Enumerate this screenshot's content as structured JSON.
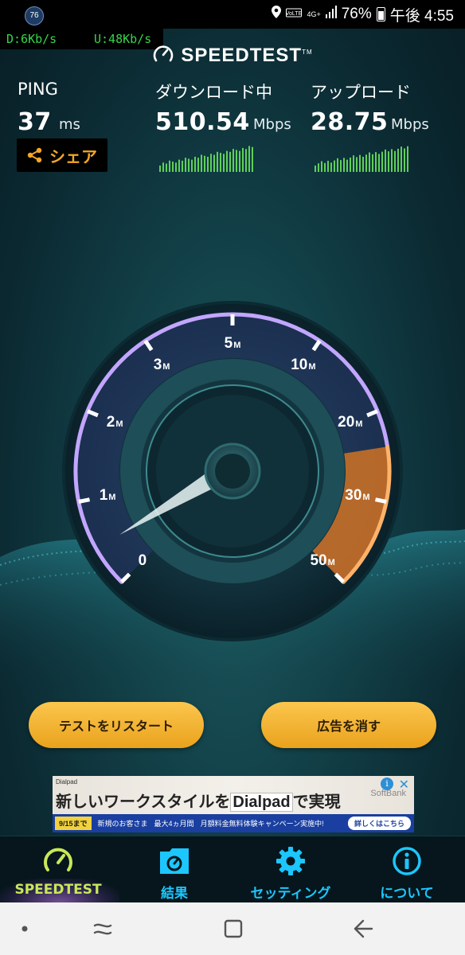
{
  "status_bar": {
    "badge": "76",
    "network_type": "4G+",
    "battery": "76%",
    "time": "午後 4:55",
    "icons": [
      "location-icon",
      "volte-icon",
      "network-4g-icon",
      "signal-icon",
      "battery-icon"
    ]
  },
  "net_monitor": {
    "download": "D:6Kb/s",
    "upload": "U:48Kb/s"
  },
  "app": {
    "logo": "SPEEDTEST",
    "trademark": "TM"
  },
  "ping": {
    "label": "PING",
    "value": "37",
    "unit": "ms"
  },
  "download": {
    "label": "ダウンロード中",
    "value": "510.54",
    "unit": "Mbps"
  },
  "upload": {
    "label": "アップロード",
    "value": "28.75",
    "unit": "Mbps"
  },
  "share": {
    "label": "シェア"
  },
  "gauge": {
    "ticks": [
      {
        "num": "0",
        "unit": ""
      },
      {
        "num": "1",
        "unit": "M"
      },
      {
        "num": "2",
        "unit": "M"
      },
      {
        "num": "3",
        "unit": "M"
      },
      {
        "num": "5",
        "unit": "M"
      },
      {
        "num": "10",
        "unit": "M"
      },
      {
        "num": "20",
        "unit": "M"
      },
      {
        "num": "30",
        "unit": "M"
      },
      {
        "num": "50",
        "unit": "M"
      }
    ]
  },
  "buttons": {
    "restart": "テストをリスタート",
    "remove_ads": "広告を消す"
  },
  "ad": {
    "brand_small": "Dialpad",
    "headline_pre": "新しいワークスタイルを",
    "headline_brand": "Dialpad",
    "headline_post": "で実現",
    "sponsor": "SoftBank",
    "date": "9/15まで",
    "line1": "新規のお客さま",
    "line2": "最大4ヵ月間",
    "line3": "月額料金無料体験キャンペーン実施中!",
    "cta": "詳しくはこちら",
    "info": "i",
    "close": "✕"
  },
  "nav": {
    "items": [
      {
        "label": "SPEEDTEST",
        "icon": "speedometer-icon",
        "active": true
      },
      {
        "label": "結果",
        "icon": "results-folder-icon",
        "active": false
      },
      {
        "label": "セッティング",
        "icon": "settings-gear-icon",
        "active": false
      },
      {
        "label": "について",
        "icon": "info-icon",
        "active": false
      }
    ]
  },
  "colors": {
    "accent": "#f6a623",
    "nav_active": "#c8e85a",
    "nav_inactive": "#1cc7ff",
    "graph_bars": "#5fd05a",
    "gauge_arc": "#9a6cff"
  }
}
